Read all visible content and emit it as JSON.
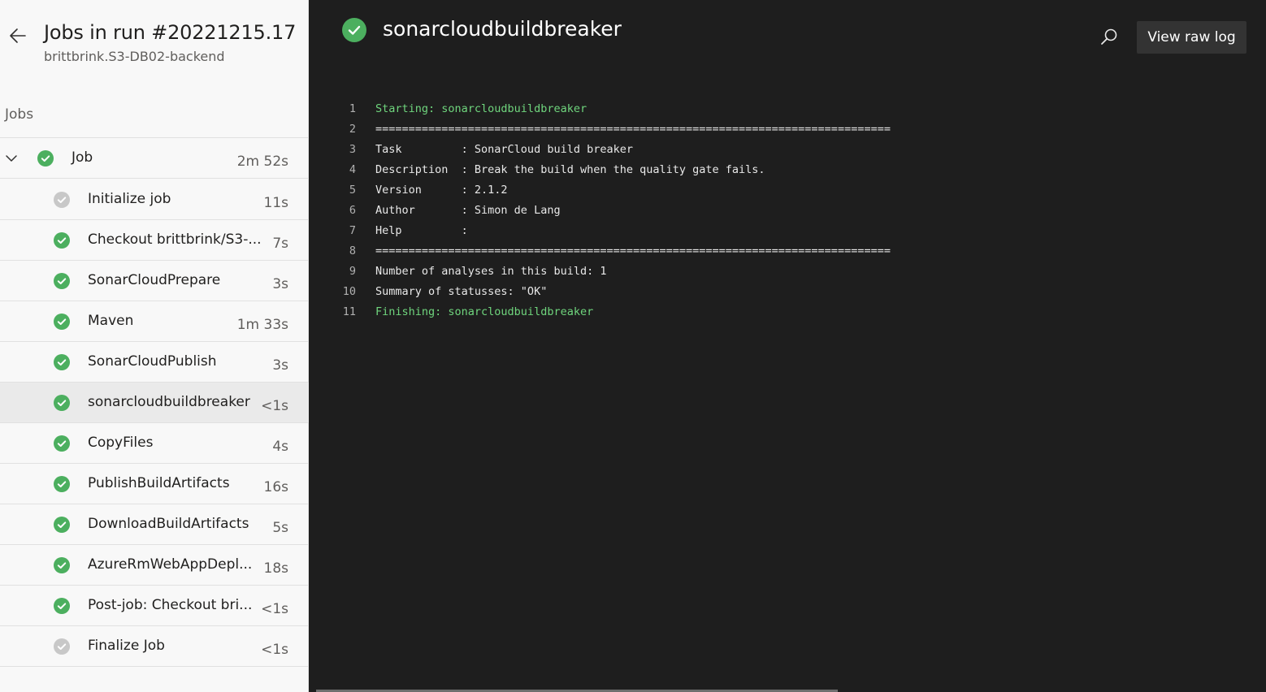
{
  "sidebar": {
    "title": "Jobs in run #20221215.17",
    "subtitle": "brittbrink.S3-DB02-backend",
    "section_label": "Jobs",
    "job": {
      "label": "Job",
      "duration": "2m 52s",
      "status": "succeeded"
    },
    "steps": [
      {
        "label": "Initialize job",
        "duration": "11s",
        "status": "skipped"
      },
      {
        "label": "Checkout brittbrink/S3-...",
        "duration": "7s",
        "status": "succeeded"
      },
      {
        "label": "SonarCloudPrepare",
        "duration": "3s",
        "status": "succeeded"
      },
      {
        "label": "Maven",
        "duration": "1m 33s",
        "status": "succeeded"
      },
      {
        "label": "SonarCloudPublish",
        "duration": "3s",
        "status": "succeeded"
      },
      {
        "label": "sonarcloudbuildbreaker",
        "duration": "<1s",
        "status": "succeeded",
        "selected": true
      },
      {
        "label": "CopyFiles",
        "duration": "4s",
        "status": "succeeded"
      },
      {
        "label": "PublishBuildArtifacts",
        "duration": "16s",
        "status": "succeeded"
      },
      {
        "label": "DownloadBuildArtifacts",
        "duration": "5s",
        "status": "succeeded"
      },
      {
        "label": "AzureRmWebAppDepl...",
        "duration": "18s",
        "status": "succeeded"
      },
      {
        "label": "Post-job: Checkout bri...",
        "duration": "<1s",
        "status": "succeeded"
      },
      {
        "label": "Finalize Job",
        "duration": "<1s",
        "status": "skipped"
      }
    ]
  },
  "log": {
    "title": "sonarcloudbuildbreaker",
    "raw_log_label": "View raw log",
    "lines": [
      {
        "num": "1",
        "text": "Starting: sonarcloudbuildbreaker",
        "highlight": true
      },
      {
        "num": "2",
        "text": "=============================================================================="
      },
      {
        "num": "3",
        "text": "Task         : SonarCloud build breaker"
      },
      {
        "num": "4",
        "text": "Description  : Break the build when the quality gate fails."
      },
      {
        "num": "5",
        "text": "Version      : 2.1.2"
      },
      {
        "num": "6",
        "text": "Author       : Simon de Lang"
      },
      {
        "num": "7",
        "text": "Help         :"
      },
      {
        "num": "8",
        "text": "=============================================================================="
      },
      {
        "num": "9",
        "text": "Number of analyses in this build: 1"
      },
      {
        "num": "10",
        "text": "Summary of statusses: \"OK\""
      },
      {
        "num": "11",
        "text": "Finishing: sonarcloudbuildbreaker",
        "highlight": true
      }
    ]
  },
  "colors": {
    "success": "#4caf5f",
    "skipped": "#c8c8c8",
    "log_highlight": "#6fd57d"
  },
  "icons": {
    "back": "arrow-left-icon",
    "expand": "chevron-down-icon",
    "success": "check-circle-icon",
    "skipped": "check-circle-gray-icon",
    "search": "search-icon"
  }
}
